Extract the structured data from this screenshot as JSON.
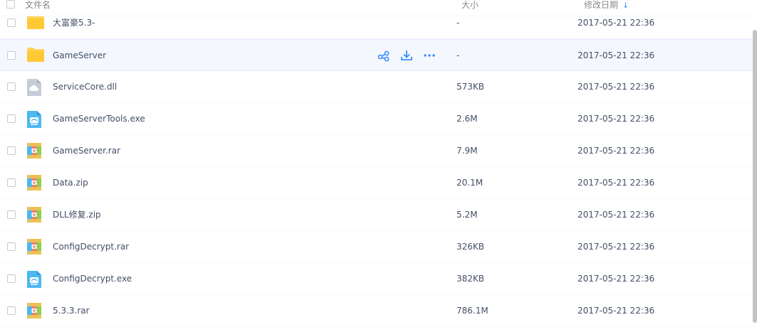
{
  "header": {
    "name_label": "文件名",
    "size_label": "大小",
    "date_label": "修改日期",
    "sort_icon": "arrow-down-icon",
    "sort_arrow": "↓"
  },
  "colors": {
    "accent": "#3b8cff",
    "folder": "#ffd25a",
    "text": "#424e67",
    "header_text": "#888888",
    "row_hover": "#f4f8fe"
  },
  "files": [
    {
      "name": "大富豪5.3-",
      "size": "-",
      "date": "2017-05-21 22:36",
      "icon": "folder-icon"
    },
    {
      "name": "GameServer",
      "size": "-",
      "date": "2017-05-21 22:36",
      "icon": "folder-icon",
      "hovered": true
    },
    {
      "name": "ServiceCore.dll",
      "size": "573KB",
      "date": "2017-05-21 22:36",
      "icon": "dll-file-icon"
    },
    {
      "name": "GameServerTools.exe",
      "size": "2.6M",
      "date": "2017-05-21 22:36",
      "icon": "exe-file-icon"
    },
    {
      "name": "GameServer.rar",
      "size": "7.9M",
      "date": "2017-05-21 22:36",
      "icon": "archive-file-icon"
    },
    {
      "name": "Data.zip",
      "size": "20.1M",
      "date": "2017-05-21 22:36",
      "icon": "archive-file-icon"
    },
    {
      "name": "DLL修复.zip",
      "size": "5.2M",
      "date": "2017-05-21 22:36",
      "icon": "archive-file-icon"
    },
    {
      "name": "ConfigDecrypt.rar",
      "size": "326KB",
      "date": "2017-05-21 22:36",
      "icon": "archive-file-icon"
    },
    {
      "name": "ConfigDecrypt.exe",
      "size": "382KB",
      "date": "2017-05-21 22:36",
      "icon": "exe-file-icon"
    },
    {
      "name": "5.3.3.rar",
      "size": "786.1M",
      "date": "2017-05-21 22:36",
      "icon": "archive-file-icon"
    }
  ],
  "row_actions": [
    "share-icon",
    "download-icon",
    "more-icon"
  ]
}
